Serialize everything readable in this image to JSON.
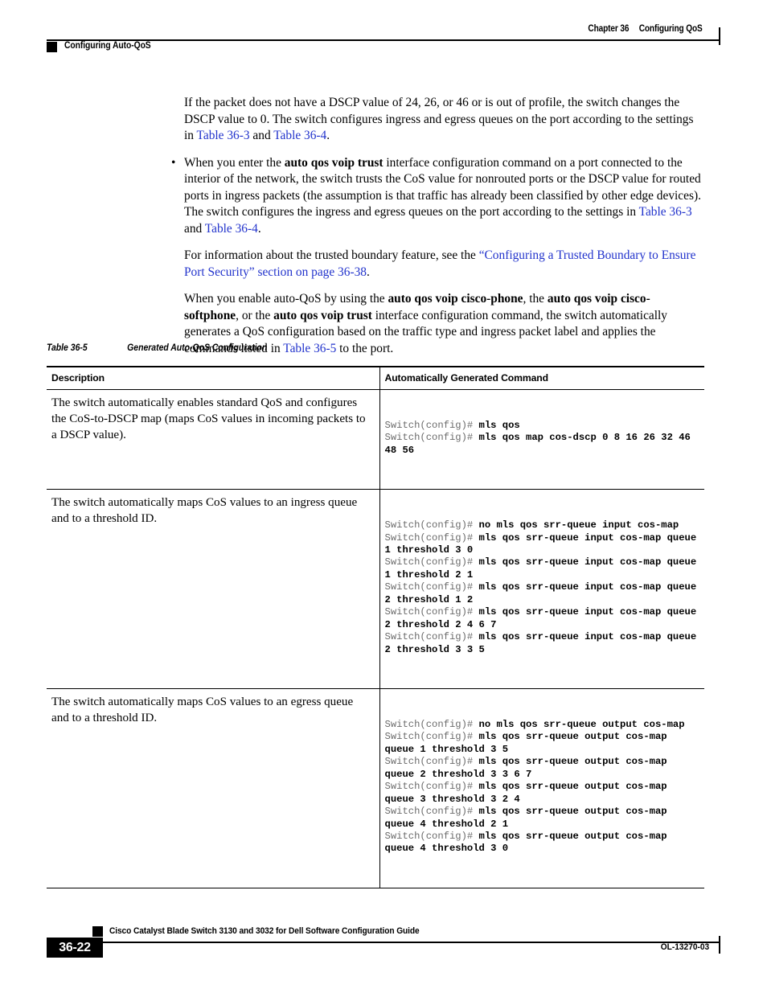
{
  "header": {
    "chapter_number": "Chapter 36",
    "chapter_title": "Configuring QoS",
    "section_title": "Configuring Auto-QoS"
  },
  "body": {
    "para1": {
      "t1": "If the packet does not have a DSCP value of 24, 26, or 46 or is out of profile, the switch changes the DSCP value to 0. The switch configures ingress and egress queues on the port according to the settings in ",
      "link1": "Table 36-3",
      "t2": " and ",
      "link2": "Table 36-4",
      "t3": "."
    },
    "bullet1": {
      "marker": "•",
      "t1": "When you enter the ",
      "b1": "auto qos voip trust",
      "t2": " interface configuration command on a port connected to the interior of the network, the switch trusts the CoS value for nonrouted ports or the DSCP value for routed ports in ingress packets (the assumption is that traffic has already been classified by other edge devices). The switch configures the ingress and egress queues on the port according to the settings in ",
      "link1": "Table 36-3",
      "t3": " and ",
      "link2": "Table 36-4",
      "t4": "."
    },
    "para2": {
      "t1": "For information about the trusted boundary feature, see the ",
      "link1": "“Configuring a Trusted Boundary to Ensure Port Security” section on page 36-38",
      "t2": "."
    },
    "para3": {
      "t1": "When you enable auto-QoS by using the ",
      "b1": "auto qos voip cisco-phone",
      "t2": ", the ",
      "b2": "auto qos voip cisco-softphone",
      "t3": ", or the ",
      "b3": "auto qos voip trust",
      "t4": " interface configuration command, the switch automatically generates a QoS configuration based on the traffic type and ingress packet label and applies the commands listed in ",
      "link1": "Table 36-5",
      "t5": " to the port."
    }
  },
  "table": {
    "caption_number": "Table 36-5",
    "caption_title": "Generated Auto-QoS Configuration",
    "columns": [
      "Description",
      "Automatically Generated Command"
    ],
    "rows": [
      {
        "description": "The switch automatically enables standard QoS and configures the CoS-to-DSCP map (maps CoS values in incoming packets to a DSCP value).",
        "commands": [
          {
            "prompt": "Switch(config)# ",
            "command": "mls qos"
          },
          {
            "prompt": "Switch(config)# ",
            "command": "mls qos map cos-dscp 0 8 16 26 32 46 48 56"
          }
        ]
      },
      {
        "description": "The switch automatically maps CoS values to an ingress queue and to a threshold ID.",
        "commands": [
          {
            "prompt": "Switch(config)# ",
            "command": "no mls qos srr-queue input cos-map"
          },
          {
            "prompt": "Switch(config)# ",
            "command": "mls qos srr-queue input cos-map queue 1 threshold 3 0"
          },
          {
            "prompt": "Switch(config)# ",
            "command": "mls qos srr-queue input cos-map queue 1 threshold 2 1"
          },
          {
            "prompt": "Switch(config)# ",
            "command": "mls qos srr-queue input cos-map queue 2 threshold 1 2"
          },
          {
            "prompt": "Switch(config)# ",
            "command": "mls qos srr-queue input cos-map queue 2 threshold 2 4 6 7"
          },
          {
            "prompt": "Switch(config)# ",
            "command": "mls qos srr-queue input cos-map queue 2 threshold 3 3 5"
          }
        ]
      },
      {
        "description": "The switch automatically maps CoS values to an egress queue and to a threshold ID.",
        "commands": [
          {
            "prompt": "Switch(config)# ",
            "command": "no mls qos srr-queue output cos-map"
          },
          {
            "prompt": "Switch(config)# ",
            "command": "mls qos srr-queue output cos-map queue 1 threshold 3 5"
          },
          {
            "prompt": "Switch(config)# ",
            "command": "mls qos srr-queue output cos-map queue 2 threshold 3 3 6 7"
          },
          {
            "prompt": "Switch(config)# ",
            "command": "mls qos srr-queue output cos-map queue 3 threshold 3 2 4"
          },
          {
            "prompt": "Switch(config)# ",
            "command": "mls qos srr-queue output cos-map queue 4 threshold 2 1"
          },
          {
            "prompt": "Switch(config)# ",
            "command": "mls qos srr-queue output cos-map queue 4 threshold 3 0"
          }
        ]
      }
    ]
  },
  "footer": {
    "guide_title": "Cisco Catalyst Blade Switch 3130 and 3032 for Dell Software Configuration Guide",
    "page_number": "36-22",
    "doc_id": "OL-13270-03"
  },
  "colors": {
    "link": "#2233cc",
    "prompt": "#6b6b6b",
    "rule": "#000000"
  }
}
